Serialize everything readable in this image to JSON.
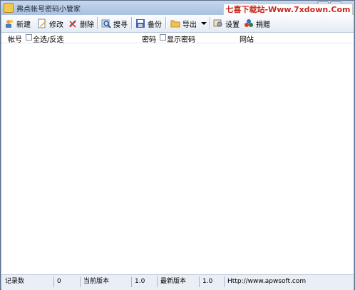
{
  "window": {
    "title": "弗点帐号密码小管家"
  },
  "watermark": "七喜下载站-Www.7xdown.Com",
  "toolbar": {
    "new": "新建",
    "edit": "修改",
    "delete": "删除",
    "search": "搜寻",
    "backup": "备份",
    "export": "导出",
    "settings": "设置",
    "donate": "捐赠"
  },
  "columns": {
    "account": "帐号",
    "select_all": "全选/反选",
    "password": "密码",
    "show_password": "显示密码",
    "website": "网站"
  },
  "status": {
    "records_label": "记录数",
    "records_value": "0",
    "current_version_label": "当前版本",
    "current_version_value": "1.0",
    "latest_version_label": "最新版本",
    "latest_version_value": "1.0",
    "website": "Http://www.apwsoft.com"
  }
}
